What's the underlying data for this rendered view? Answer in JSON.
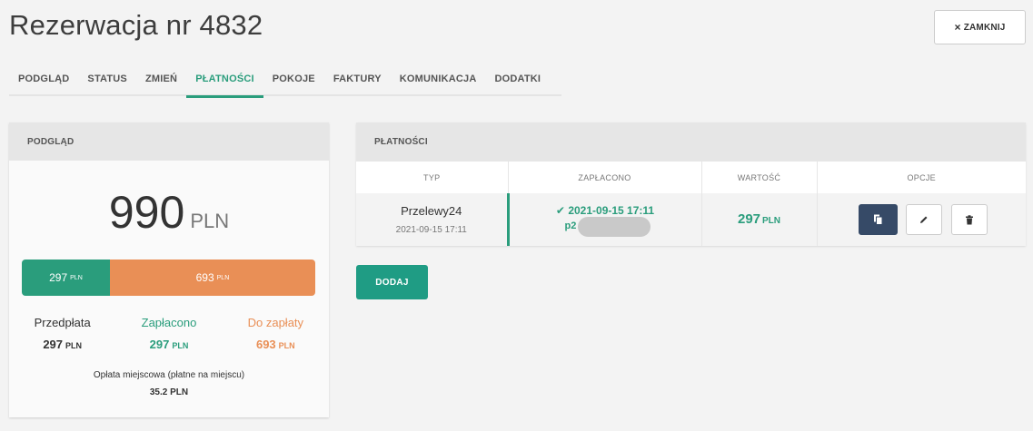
{
  "header": {
    "title": "Rezerwacja nr 4832",
    "close_label": "ZAMKNIJ"
  },
  "tabs": [
    {
      "label": "PODGLĄD",
      "active": false
    },
    {
      "label": "STATUS",
      "active": false
    },
    {
      "label": "ZMIEŃ",
      "active": false
    },
    {
      "label": "PŁATNOŚCI",
      "active": true
    },
    {
      "label": "POKOJE",
      "active": false
    },
    {
      "label": "FAKTURY",
      "active": false
    },
    {
      "label": "KOMUNIKACJA",
      "active": false
    },
    {
      "label": "DODATKI",
      "active": false
    }
  ],
  "summary": {
    "heading": "PODGLĄD",
    "total": "990",
    "currency": "PLN",
    "bar": {
      "paid_value": "297",
      "paid_currency": "PLN",
      "due_value": "693",
      "due_currency": "PLN",
      "paid_fraction": 0.3
    },
    "stats": [
      {
        "label": "Przedpłata",
        "value": "297",
        "currency": "PLN"
      },
      {
        "label": "Zapłacono",
        "value": "297",
        "currency": "PLN"
      },
      {
        "label": "Do zapłaty",
        "value": "693",
        "currency": "PLN"
      }
    ],
    "fee_label": "Opłata miejscowa (płatne na miejscu)",
    "fee_value": "35.2 PLN"
  },
  "payments": {
    "heading": "PŁATNOŚCI",
    "columns": [
      "TYP",
      "ZAPŁACONO",
      "WARTOŚĆ",
      "OPCJE"
    ],
    "rows": [
      {
        "method": "Przelewy24",
        "method_date": "2021-09-15 17:11",
        "paid_check": "✔",
        "paid_date": "2021-09-15 17:11",
        "paid_ref": "p2",
        "amount": "297",
        "currency": "PLN"
      }
    ],
    "add_label": "DODAJ"
  },
  "colors": {
    "accent": "#2a9d7c",
    "due": "#e98f56",
    "dark_button": "#364a67"
  }
}
